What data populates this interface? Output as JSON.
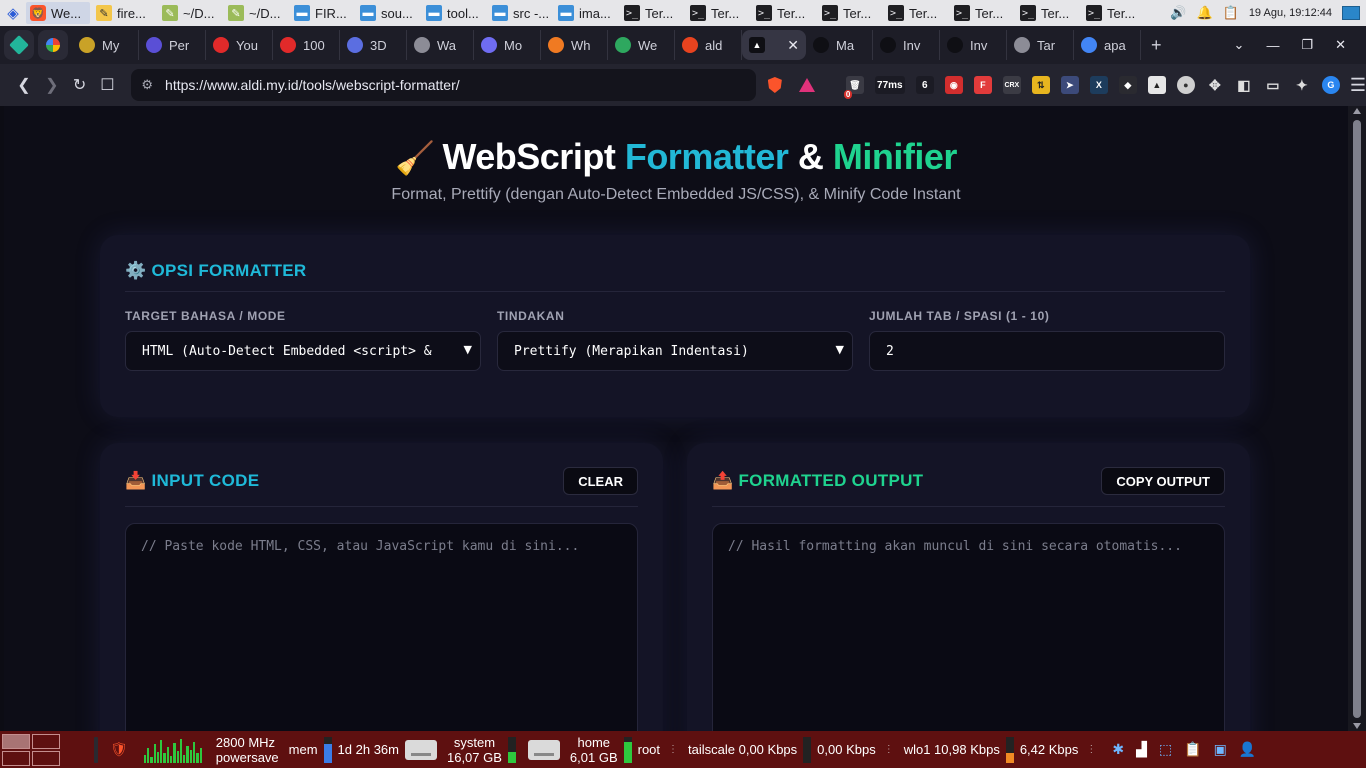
{
  "system_panel": {
    "tasks": [
      {
        "label": "We...",
        "icon": "brave-browser-icon",
        "kind": "brave"
      },
      {
        "label": "fire...",
        "icon": "text-editor-icon",
        "kind": "note"
      },
      {
        "label": "~/D...",
        "icon": "text-editor-icon",
        "kind": "edit"
      },
      {
        "label": "~/D...",
        "icon": "text-editor-icon",
        "kind": "edit"
      },
      {
        "label": "FIR...",
        "icon": "folder-icon",
        "kind": "folder"
      },
      {
        "label": "sou...",
        "icon": "folder-icon",
        "kind": "folder"
      },
      {
        "label": "tool...",
        "icon": "folder-icon",
        "kind": "folder"
      },
      {
        "label": "src -...",
        "icon": "folder-icon",
        "kind": "folder"
      },
      {
        "label": "ima...",
        "icon": "folder-icon",
        "kind": "folder"
      },
      {
        "label": "Ter...",
        "icon": "terminal-icon",
        "kind": "term"
      },
      {
        "label": "Ter...",
        "icon": "terminal-icon",
        "kind": "term"
      },
      {
        "label": "Ter...",
        "icon": "terminal-icon",
        "kind": "term"
      },
      {
        "label": "Ter...",
        "icon": "terminal-icon",
        "kind": "term"
      },
      {
        "label": "Ter...",
        "icon": "terminal-icon",
        "kind": "term"
      },
      {
        "label": "Ter...",
        "icon": "terminal-icon",
        "kind": "term"
      },
      {
        "label": "Ter...",
        "icon": "terminal-icon",
        "kind": "term"
      },
      {
        "label": "Ter...",
        "icon": "terminal-icon",
        "kind": "term"
      }
    ],
    "clock": "19 Agu, 19:12:44"
  },
  "browser": {
    "tabs": [
      {
        "label": "My",
        "color": "#c9a227"
      },
      {
        "label": "Per",
        "color": "#5a4fd6"
      },
      {
        "label": "You",
        "color": "#e12a2a"
      },
      {
        "label": "100",
        "color": "#e12a2a"
      },
      {
        "label": "3D",
        "color": "#5b6ee1"
      },
      {
        "label": "Wa",
        "color": "#8c8c96"
      },
      {
        "label": "Mo",
        "color": "#6f6cf1"
      },
      {
        "label": "Wh",
        "color": "#f07a22"
      },
      {
        "label": "We",
        "color": "#2ea85f"
      },
      {
        "label": "ald",
        "color": "#e8431f"
      },
      {
        "label": "Ma",
        "color": "#0f0f14"
      },
      {
        "label": "Inv",
        "color": "#0f0f14"
      },
      {
        "label": "Inv",
        "color": "#0f0f14"
      },
      {
        "label": "Tar",
        "color": "#8c8c96"
      },
      {
        "label": "apa",
        "color": "#4285f4"
      }
    ],
    "url": "https://www.aldi.my.id/tools/webscript-formatter/",
    "ext_badge_count": "0",
    "ext_ping": "77ms",
    "ext_text_label": "6"
  },
  "page": {
    "title_plain": "WebScript",
    "title_cyan": "Formatter",
    "title_amp": "&",
    "title_green": "Minifier",
    "subtitle": "Format, Prettify (dengan Auto-Detect Embedded JS/CSS), & Minify Code Instant",
    "options": {
      "heading": "OPSI FORMATTER",
      "mode_label": "TARGET BAHASA / MODE",
      "mode_value": "HTML (Auto-Detect Embedded <script> &",
      "action_label": "TINDAKAN",
      "action_value": "Prettify (Merapikan Indentasi)",
      "indent_label": "JUMLAH TAB / SPASI (1 - 10)",
      "indent_value": "2"
    },
    "input": {
      "heading": "INPUT CODE",
      "clear_label": "CLEAR",
      "placeholder": "// Paste kode HTML, CSS, atau JavaScript kamu di sini..."
    },
    "output": {
      "heading": "FORMATTED OUTPUT",
      "copy_label": "COPY OUTPUT",
      "placeholder": "// Hasil formatting akan muncul di sini secara otomatis..."
    }
  },
  "bottom_panel": {
    "cpu_freq": "2800 MHz",
    "cpu_gov": "powersave",
    "mem_label": "mem",
    "uptime": "1d 2h 36m",
    "disk1_name": "system",
    "disk1_free": "16,07 GB",
    "disk2_name": "home",
    "disk2_free": "6,01 GB",
    "user": "root",
    "net1": "tailscale 0,00 Kbps",
    "net1_up": "0,00 Kbps",
    "net2": "wlo1 10,98 Kbps",
    "net2_up": "6,42 Kbps"
  }
}
